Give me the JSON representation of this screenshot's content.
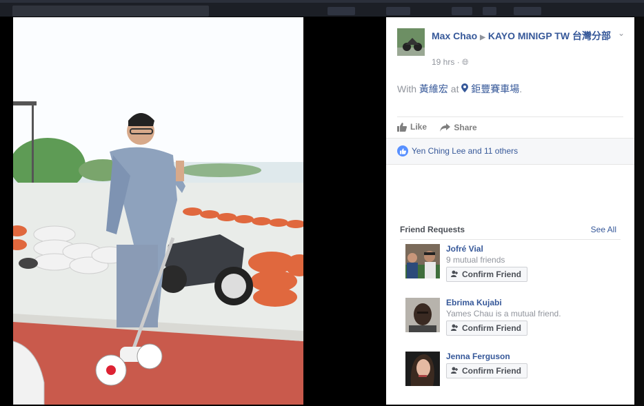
{
  "post": {
    "author": "Max Chao",
    "group": "KAYO MINIGP TW 台灣分部",
    "time": "19 hrs",
    "with_prefix": "With",
    "tagged_person": "黃維宏",
    "at_word": "at",
    "location": "鉅豐賽車場",
    "like_label": "Like",
    "share_label": "Share",
    "likes_text": "Yen Ching Lee and 11 others"
  },
  "friend_requests": {
    "title": "Friend Requests",
    "see_all": "See All",
    "items": [
      {
        "name": "Jofré Vial",
        "mutual": "9 mutual friends",
        "button": "Confirm Friend"
      },
      {
        "name": "Ebrima Kujabi",
        "mutual": "Yames Chau is a mutual friend.",
        "button": "Confirm Friend"
      },
      {
        "name": "Jenna Ferguson",
        "mutual": "",
        "button": "Confirm Friend"
      }
    ]
  },
  "colors": {
    "link": "#365899",
    "muted": "#90949c",
    "like_blue": "#5890ff"
  }
}
